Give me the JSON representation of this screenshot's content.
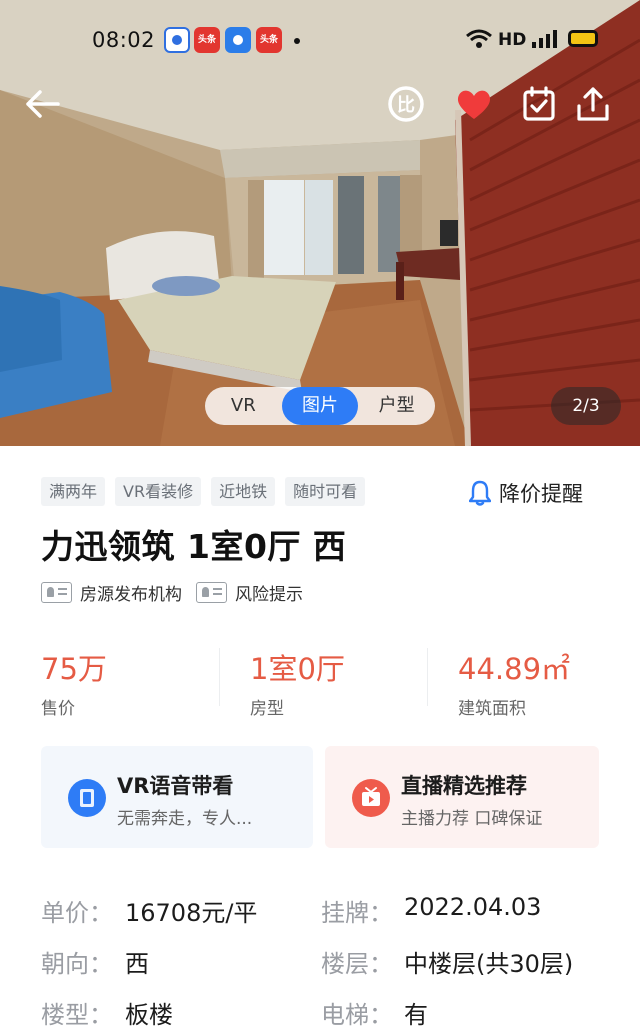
{
  "status_bar": {
    "time": "08:02",
    "apps": [
      "baidu-app-icon",
      "toutiao-app-icon",
      "browser-app-icon",
      "toutiao-app-icon"
    ],
    "app_badge_text": "头条",
    "network": "HD",
    "signal": "4G"
  },
  "header": {
    "compare_icon_text": "比",
    "favorite_color": "#f03b3b"
  },
  "media": {
    "tabs": [
      "VR",
      "图片",
      "户型"
    ],
    "active_tab": "图片",
    "counter": "2/3"
  },
  "listing": {
    "tags": [
      "满两年",
      "VR看装修",
      "近地铁",
      "随时可看"
    ],
    "price_alert": "降价提醒",
    "title": "力迅领筑 1室0厅 西",
    "meta": [
      "房源发布机构",
      "风险提示"
    ]
  },
  "stats": [
    {
      "value": "75万",
      "label": "售价"
    },
    {
      "value": "1室0厅",
      "label": "房型"
    },
    {
      "value": "44.89㎡",
      "label": "建筑面积"
    }
  ],
  "cards": {
    "vr": {
      "title": "VR语音带看",
      "subtitle": "无需奔走，专人..."
    },
    "live": {
      "title": "直播精选推荐",
      "subtitle": "主播力荐 口碑保证"
    }
  },
  "details": [
    {
      "label": "单价：",
      "value": "16708元/平"
    },
    {
      "label": "挂牌：",
      "value": "2022.04.03"
    },
    {
      "label": "朝向：",
      "value": "西"
    },
    {
      "label": "楼层：",
      "value": "中楼层(共30层)"
    },
    {
      "label": "楼型：",
      "value": "板楼"
    },
    {
      "label": "电梯：",
      "value": "有"
    }
  ],
  "colors": {
    "accent": "#2e7cf6",
    "price": "#e55b44"
  }
}
